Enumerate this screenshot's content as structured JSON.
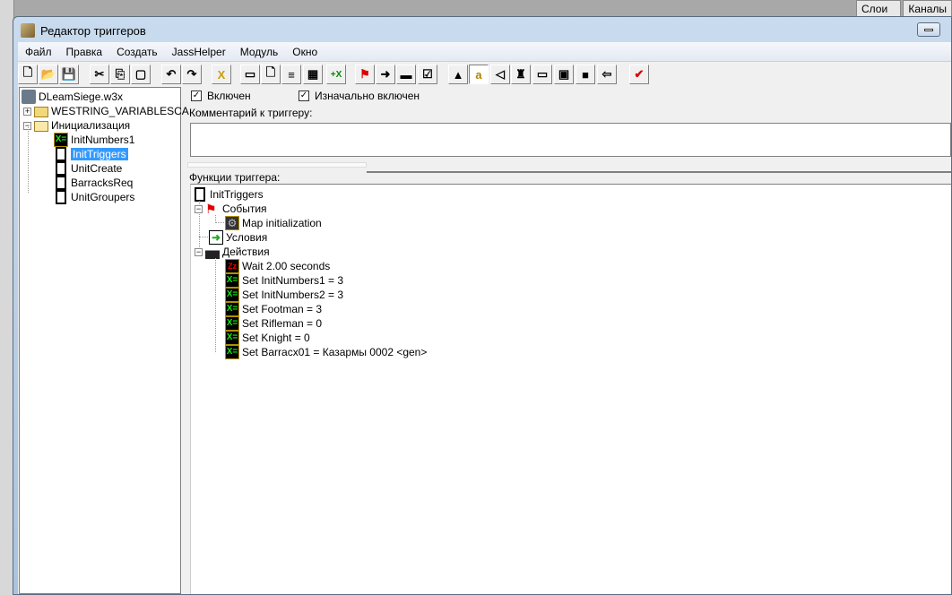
{
  "window": {
    "title": "Редактор триггеров"
  },
  "background_tabs": [
    "Слои ×",
    "Каналы"
  ],
  "menu": [
    "Файл",
    "Правка",
    "Создать",
    "JassHelper",
    "Модуль",
    "Окно"
  ],
  "toolbar": [
    "new",
    "open",
    "save",
    "cut",
    "copy",
    "paste",
    "undo",
    "redo",
    "variables",
    "new-category",
    "new-trigger",
    "new-comment",
    "script",
    "new-variable",
    "new-event",
    "new-condition",
    "new-action",
    "checklist",
    "terrain",
    "text",
    "sound",
    "unit",
    "item",
    "ai",
    "object",
    "import",
    "test-map"
  ],
  "tree": {
    "root": "DLeamSiege.w3x",
    "items": [
      {
        "label": "WESTRING_VARIABLESCA",
        "type": "folder",
        "expanded": false
      },
      {
        "label": "Инициализация",
        "type": "folder",
        "expanded": true,
        "children": [
          {
            "label": "InitNumbers1",
            "type": "variable"
          },
          {
            "label": "InitTriggers",
            "type": "trigger",
            "selected": true
          },
          {
            "label": "UnitCreate",
            "type": "trigger"
          },
          {
            "label": "BarracksReq",
            "type": "trigger"
          },
          {
            "label": "UnitGroupers",
            "type": "trigger"
          }
        ]
      }
    ]
  },
  "trigger": {
    "enabled_label": "Включен",
    "enabled": true,
    "initially_on_label": "Изначально включен",
    "initially_on": true,
    "comment_label": "Комментарий к триггеру:",
    "comment": "",
    "functions_label": "Функции триггера:",
    "name": "InitTriggers",
    "events_label": "События",
    "events": [
      "Map initialization"
    ],
    "conditions_label": "Условия",
    "actions_label": "Действия",
    "actions": [
      "Wait 2.00 seconds",
      "Set InitNumbers1 = 3",
      "Set InitNumbers2 = 3",
      "Set Footman = 3",
      "Set Rifleman = 0",
      "Set Knight = 0",
      "Set Barracx01 = Казармы 0002 <gen>"
    ]
  }
}
